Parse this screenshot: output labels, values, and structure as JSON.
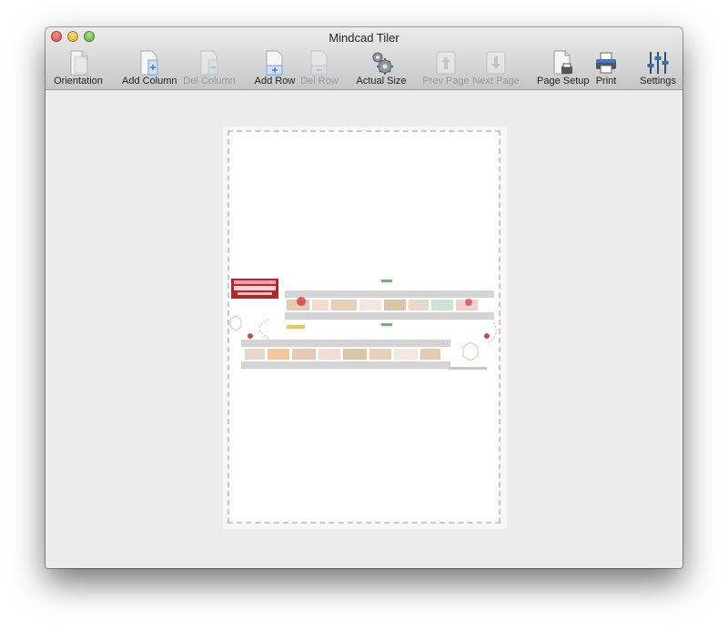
{
  "window": {
    "title": "Mindcad Tiler"
  },
  "toolbar": {
    "orientation": "Orientation",
    "add_column": "Add Column",
    "del_column": "Del Column",
    "add_row": "Add Row",
    "del_row": "Del Row",
    "actual_size": "Actual Size",
    "prev_page": "Prev Page",
    "next_page": "Next Page",
    "page_setup": "Page Setup",
    "print": "Print",
    "settings": "Settings"
  },
  "colors": {
    "accent": "#5b8ad6",
    "disabled": "#9a9a9a",
    "map_red": "#b5252f"
  }
}
